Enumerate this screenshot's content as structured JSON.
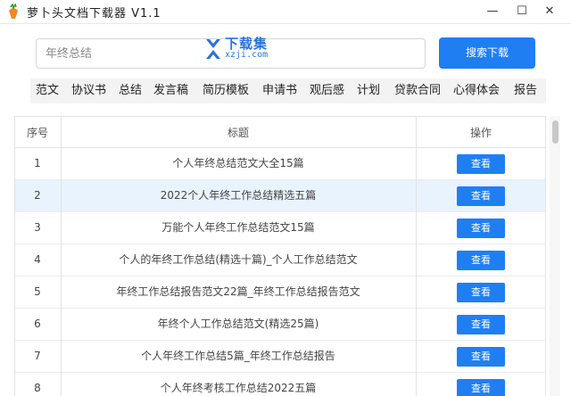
{
  "window": {
    "title": "萝卜头文档下载器  V1.1",
    "min_glyph": "—",
    "max_glyph": "☐",
    "close_glyph": "✕"
  },
  "watermark": {
    "brand": "下载集",
    "url": "xzji.com"
  },
  "search": {
    "placeholder": "年终总结",
    "value": "",
    "button_label": "搜索下载"
  },
  "categories": [
    "范文",
    "协议书",
    "总结",
    "发言稿",
    "简历模板",
    "申请书",
    "观后感",
    "计划",
    "贷款合同",
    "心得体会",
    "报告"
  ],
  "table": {
    "headers": {
      "index": "序号",
      "title": "标题",
      "action": "操作"
    },
    "rows": [
      {
        "index": "1",
        "title": "个人年终总结范文大全15篇",
        "action": "查看"
      },
      {
        "index": "2",
        "title": "2022个人年终工作总结精选五篇",
        "action": "查看"
      },
      {
        "index": "3",
        "title": "万能个人年终工作总结范文15篇",
        "action": "查看"
      },
      {
        "index": "4",
        "title": "个人的年终工作总结(精选十篇)_个人工作总结范文",
        "action": "查看"
      },
      {
        "index": "5",
        "title": "年终工作总结报告范文22篇_年终工作总结报告范文",
        "action": "查看"
      },
      {
        "index": "6",
        "title": "年终个人工作总结范文(精选25篇)",
        "action": "查看"
      },
      {
        "index": "7",
        "title": "个人年终工作总结5篇_年终工作总结报告",
        "action": "查看"
      },
      {
        "index": "8",
        "title": "个人年终考核工作总结2022五篇",
        "action": "查看"
      }
    ],
    "selected_row": 2
  },
  "colors": {
    "accent": "#1f7ff2",
    "selected_row": "#e9f3fd"
  }
}
